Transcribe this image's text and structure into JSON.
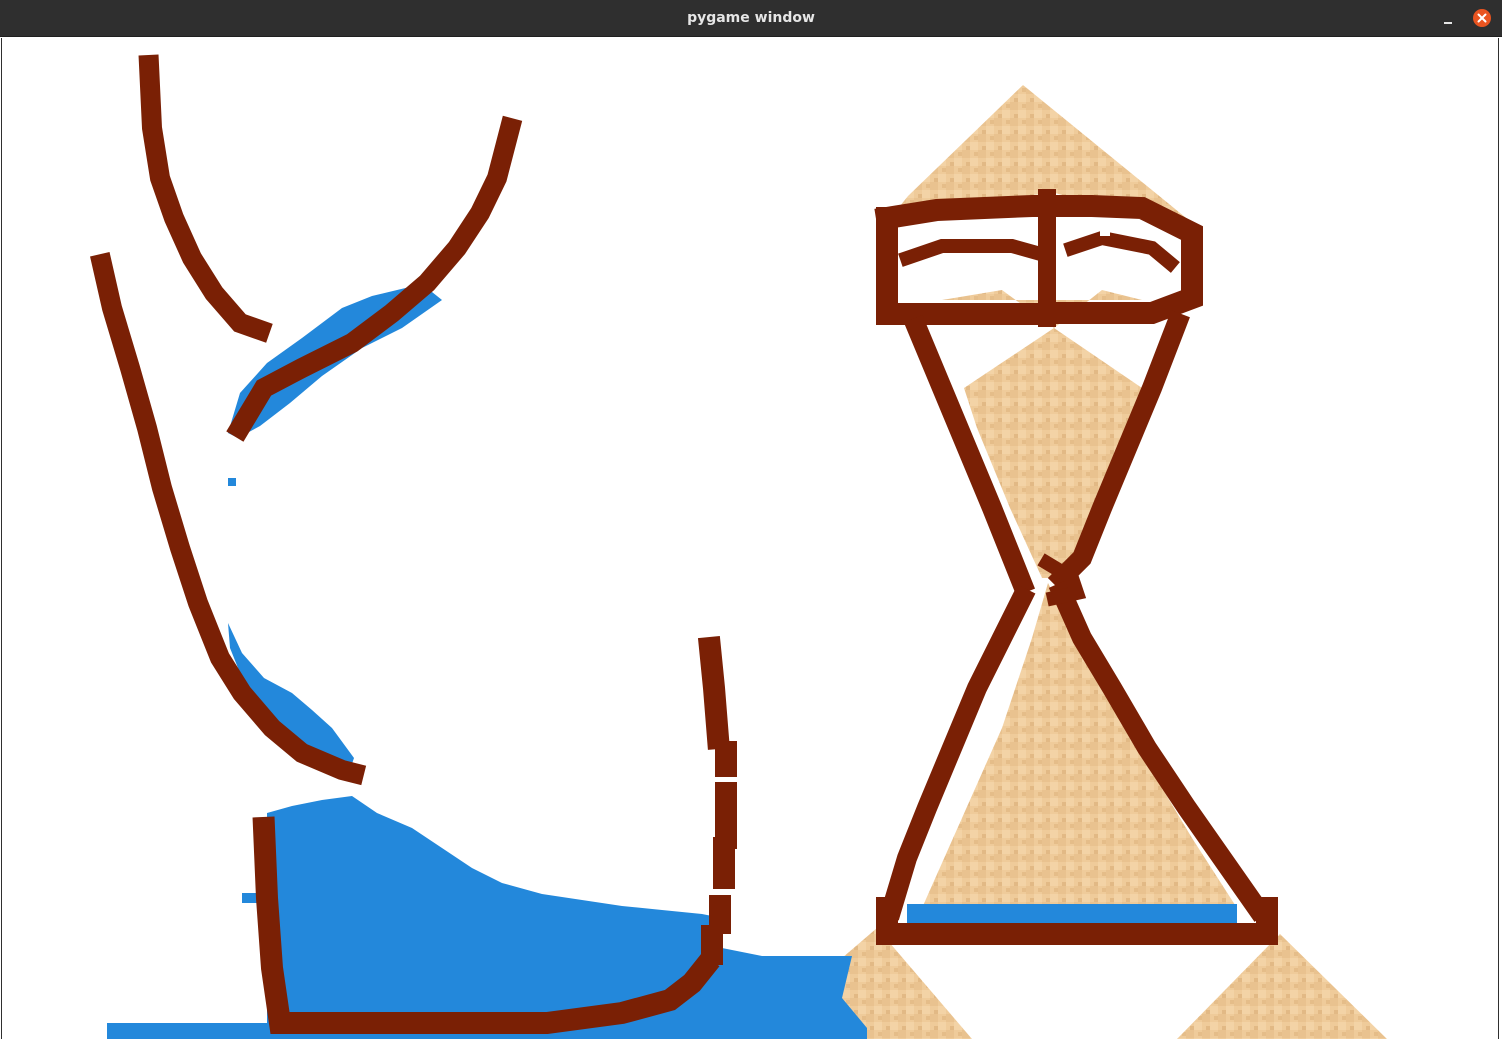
{
  "window": {
    "title": "pygame window",
    "close_color": "#e95420"
  },
  "scene": {
    "colors": {
      "background": "#ffffff",
      "wall": "#7a2005",
      "water": "#2388db",
      "sand": "#efcb9a",
      "sand_dark": "#e2b985"
    },
    "materials": [
      "wall",
      "water",
      "sand"
    ]
  }
}
